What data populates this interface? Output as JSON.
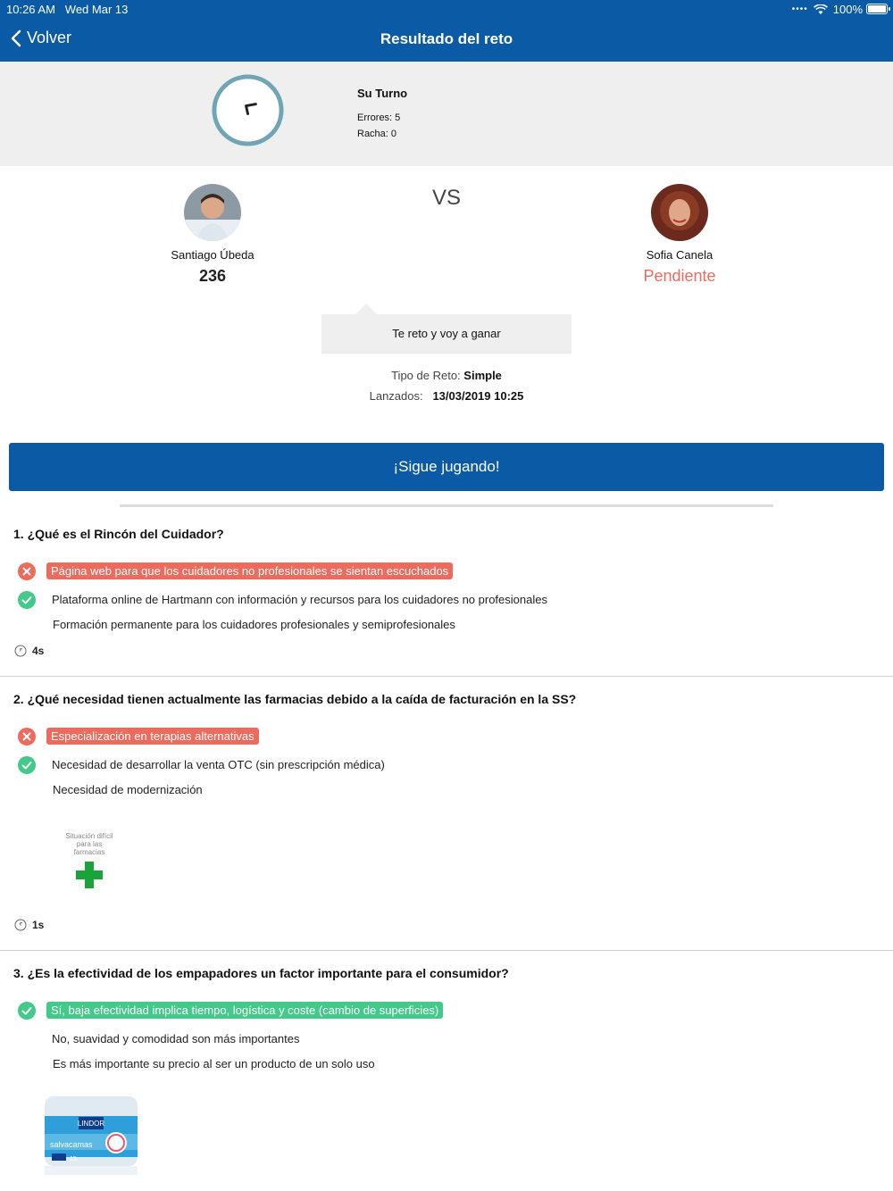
{
  "status_bar": {
    "time": "10:26 AM",
    "date": "Wed Mar 13",
    "battery": "100%"
  },
  "nav": {
    "back_label": "Volver",
    "title": "Resultado del reto"
  },
  "turn": {
    "title": "Su Turno",
    "errors": "Errores: 5",
    "streak": "Racha: 0"
  },
  "players": {
    "left": {
      "name": "Santiago Úbeda",
      "score": "236"
    },
    "vs": "VS",
    "right": {
      "name": "Sofia  Canela",
      "status": "Pendiente"
    }
  },
  "challenge": {
    "message": "Te reto y voy a ganar",
    "type_label": "Tipo de Reto:",
    "type_value": "Simple",
    "launched_label": "Lanzados:",
    "launched_value": "13/03/2019 10:25"
  },
  "play_button": "¡Sigue jugando!",
  "questions": [
    {
      "title": "1. ¿Qué es el Rincón del Cuidador?",
      "answers": [
        {
          "text": "Página web para que los cuidadores no profesionales se sientan escuchados",
          "state": "wrong"
        },
        {
          "text": "Plataforma online de Hartmann con información y recursos para los cuidadores no profesionales",
          "state": "correct"
        },
        {
          "text": "Formación permanente para los cuidadores profesionales y semiprofesionales",
          "state": "none"
        }
      ],
      "time": "4s"
    },
    {
      "title": "2. ¿Qué necesidad tienen actualmente las farmacias debido a la caída de facturación en la SS?",
      "answers": [
        {
          "text": "Especialización en terapias alternativas",
          "state": "wrong"
        },
        {
          "text": "Necesidad de desarrollar la venta OTC (sin prescripción médica)",
          "state": "correct"
        },
        {
          "text": "Necesidad de modernización",
          "state": "none"
        }
      ],
      "image_caption": "Situación difícil para las farmacias",
      "time": "1s"
    },
    {
      "title": "3. ¿Es la efectividad de los empapadores un factor importante para el consumidor?",
      "answers": [
        {
          "text": "Sí, baja efectividad implica tiempo, logística y coste (cambio de superficies)",
          "state": "selected-correct"
        },
        {
          "text": "No, suavidad y comodidad son más importantes",
          "state": "none"
        },
        {
          "text": "Es más importante su precio al ser un producto de un solo uso",
          "state": "none"
        }
      ],
      "product": {
        "brand": "LINDOR",
        "name": "salvacamas",
        "count": "15"
      }
    }
  ]
}
